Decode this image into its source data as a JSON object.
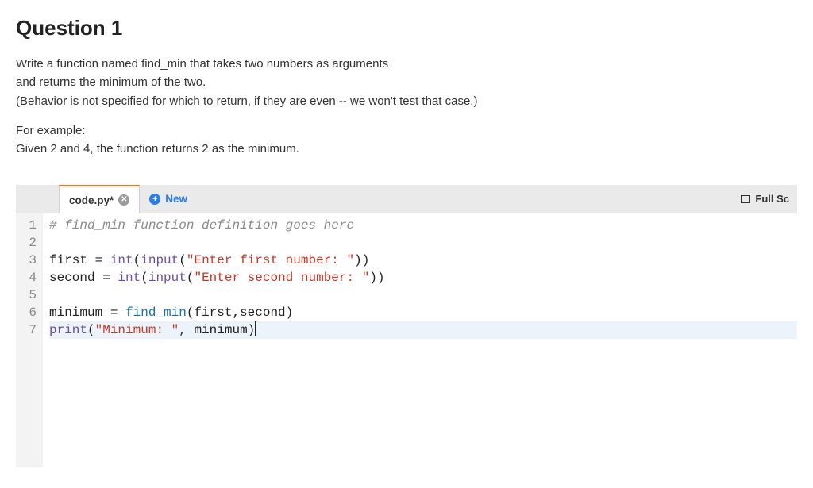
{
  "title": "Question 1",
  "prompt": {
    "line1": "Write a function named find_min that takes two numbers as arguments",
    "line2": "and returns the minimum of the two.",
    "line3": "(Behavior is not specified for which to return, if they are even -- we won't test that case.)",
    "line4": "For example:",
    "line5": "Given 2 and 4, the function returns 2 as the minimum."
  },
  "tabs": {
    "active_label": "code.py*",
    "new_label": "New"
  },
  "toolbar": {
    "fullscreen_label": "Full Sc"
  },
  "code": {
    "line_numbers": [
      "1",
      "2",
      "3",
      "4",
      "5",
      "6",
      "7"
    ],
    "l1_comment": "# find_min function definition goes here",
    "l3": {
      "ident": "first ",
      "op": "= ",
      "int": "int",
      "lp": "(",
      "input": "input",
      "lp2": "(",
      "str": "\"Enter first number: \"",
      "rp": "))"
    },
    "l4": {
      "ident": "second ",
      "op": "= ",
      "int": "int",
      "lp": "(",
      "input": "input",
      "lp2": "(",
      "str": "\"Enter second number: \"",
      "rp": "))"
    },
    "l6": {
      "ident": "minimum ",
      "op": "= ",
      "call": "find_min",
      "args": "(first,second)"
    },
    "l7": {
      "print": "print",
      "lp": "(",
      "str": "\"Minimum: \"",
      "comma": ", ",
      "arg": "minimum",
      "rp": ")"
    }
  }
}
